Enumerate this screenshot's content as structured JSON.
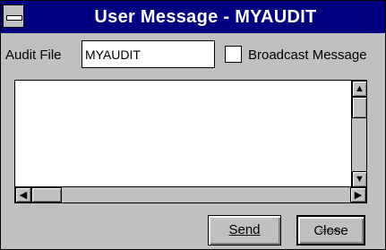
{
  "window": {
    "title": "User Message - MYAUDIT"
  },
  "form": {
    "audit_file_label": "Audit File",
    "audit_file_value": "MYAUDIT",
    "broadcast_label": "Broadcast Message",
    "broadcast_checked": false
  },
  "memo": {
    "text": ""
  },
  "buttons": {
    "send": "Send",
    "close": "Close"
  },
  "icons": {
    "system_menu": "system-menu-icon",
    "scroll_up": "arrow-up-icon",
    "scroll_down": "arrow-down-icon",
    "scroll_left": "arrow-left-icon",
    "scroll_right": "arrow-right-icon"
  },
  "colors": {
    "titlebar": "#000080",
    "face": "#c0c0c0",
    "field": "#ffffff"
  }
}
